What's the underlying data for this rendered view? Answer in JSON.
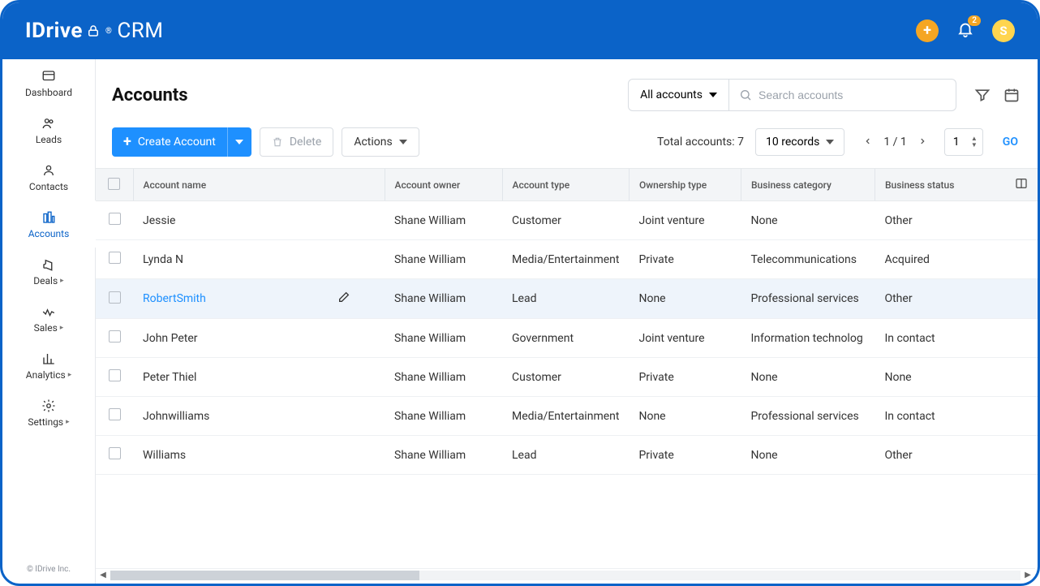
{
  "brand": {
    "name": "IDrive",
    "suffix": "CRM",
    "avatar_initial": "S",
    "notif_count": "2"
  },
  "sidebar": {
    "items": [
      {
        "label": "Dashboard",
        "has_caret": false
      },
      {
        "label": "Leads",
        "has_caret": false
      },
      {
        "label": "Contacts",
        "has_caret": false
      },
      {
        "label": "Accounts",
        "has_caret": false
      },
      {
        "label": "Deals",
        "has_caret": true
      },
      {
        "label": "Sales",
        "has_caret": true
      },
      {
        "label": "Analytics",
        "has_caret": true
      },
      {
        "label": "Settings",
        "has_caret": true
      }
    ],
    "copyright": "© IDrive Inc."
  },
  "page": {
    "title": "Accounts",
    "filter_label": "All accounts",
    "search_placeholder": "Search accounts"
  },
  "toolbar": {
    "create_label": "Create Account",
    "delete_label": "Delete",
    "actions_label": "Actions",
    "total_prefix": "Total accounts:",
    "total_value": "7",
    "records_label": "10 records",
    "page_info": "1 / 1",
    "page_input": "1",
    "go_label": "GO"
  },
  "table": {
    "columns": [
      "Account name",
      "Account owner",
      "Account type",
      "Ownership type",
      "Business category",
      "Business status"
    ],
    "rows": [
      {
        "name": "Jessie",
        "owner": "Shane William",
        "type": "Customer",
        "ownership": "Joint venture",
        "category": "None",
        "status": "Other"
      },
      {
        "name": "Lynda N",
        "owner": "Shane William",
        "type": "Media/Entertainment",
        "ownership": "Private",
        "category": "Telecommunications",
        "status": "Acquired"
      },
      {
        "name": "RobertSmith",
        "owner": "Shane William",
        "type": "Lead",
        "ownership": "None",
        "category": "Professional services",
        "status": "Other"
      },
      {
        "name": "John Peter",
        "owner": "Shane William",
        "type": "Government",
        "ownership": "Joint venture",
        "category": "Information technolog",
        "status": "In contact"
      },
      {
        "name": "Peter Thiel",
        "owner": "Shane William",
        "type": "Customer",
        "ownership": "Private",
        "category": "None",
        "status": "None"
      },
      {
        "name": "Johnwilliams",
        "owner": "Shane William",
        "type": "Media/Entertainment",
        "ownership": "None",
        "category": "Professional services",
        "status": "In contact"
      },
      {
        "name": "Williams",
        "owner": "Shane William",
        "type": "Lead",
        "ownership": "Private",
        "category": "None",
        "status": "Other"
      }
    ],
    "hover_index": 2
  }
}
